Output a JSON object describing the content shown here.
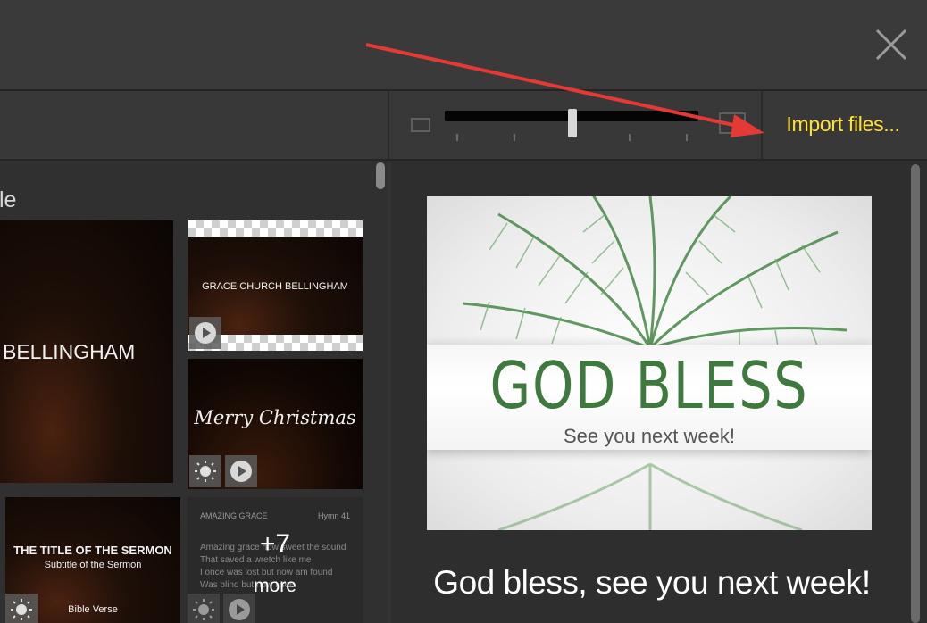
{
  "toolbar": {
    "import_label": "Import files..."
  },
  "library": {
    "section_title": "tle",
    "items": [
      {
        "caption": "H BELLINGHAM"
      },
      {
        "caption": "GRACE CHURCH BELLINGHAM"
      },
      {
        "caption": "Merry Christmas"
      },
      {
        "caption": "THE TITLE OF THE SERMON",
        "subtitle": "Subtitle of the Sermon",
        "footer": "Bible Verse"
      },
      {
        "header_left": "AMAZING GRACE",
        "header_right": "Hymn 41",
        "lines": [
          "Amazing grace how sweet the sound",
          "That saved a wretch like me",
          "I once was lost but now am found",
          "Was blind but now I see"
        ]
      }
    ],
    "more_count": "+7",
    "more_label": "more"
  },
  "preview": {
    "title": "GOD BLESS",
    "subtitle": "See you next week!",
    "caption": "God bless, see you next week!"
  },
  "colors": {
    "accent": "#ffe033",
    "annotation_arrow": "#e53935",
    "preview_green": "#3e7a3e"
  }
}
